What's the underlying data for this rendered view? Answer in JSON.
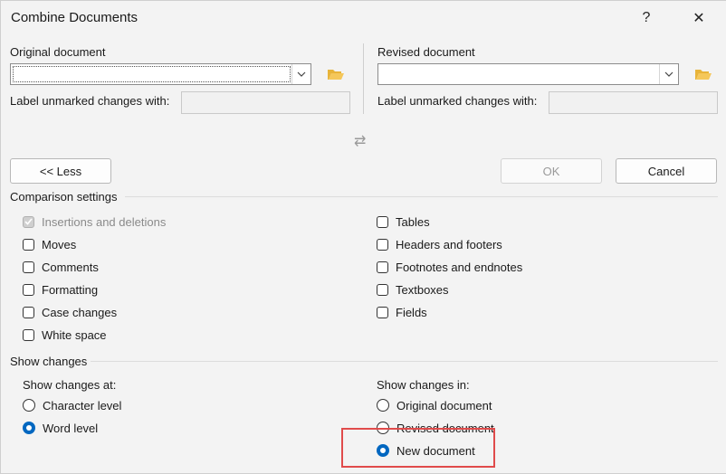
{
  "window": {
    "title": "Combine Documents",
    "help": "?",
    "close": "✕"
  },
  "original": {
    "heading": "Original document",
    "label_unmarked": "Label unmarked changes with:",
    "value": "",
    "label_value": ""
  },
  "revised": {
    "heading": "Revised document",
    "label_unmarked": "Label unmarked changes with:",
    "value": "",
    "label_value": ""
  },
  "swap_glyph": "⇄",
  "buttons": {
    "less": "<< Less",
    "ok": "OK",
    "cancel": "Cancel"
  },
  "comparison": {
    "heading": "Comparison settings",
    "left": [
      {
        "label": "Insertions and deletions",
        "checked": true,
        "disabled": true
      },
      {
        "label": "Moves",
        "checked": false
      },
      {
        "label": "Comments",
        "checked": false
      },
      {
        "label": "Formatting",
        "checked": false
      },
      {
        "label": "Case changes",
        "checked": false
      },
      {
        "label": "White space",
        "checked": false
      }
    ],
    "right": [
      {
        "label": "Tables",
        "checked": false
      },
      {
        "label": "Headers and footers",
        "checked": false
      },
      {
        "label": "Footnotes and endnotes",
        "checked": false
      },
      {
        "label": "Textboxes",
        "checked": false
      },
      {
        "label": "Fields",
        "checked": false
      }
    ]
  },
  "show": {
    "heading": "Show changes",
    "at_heading": "Show changes at:",
    "at_options": [
      {
        "label": "Character level",
        "selected": false
      },
      {
        "label": "Word level",
        "selected": true
      }
    ],
    "in_heading": "Show changes in:",
    "in_options": [
      {
        "label": "Original document",
        "selected": false
      },
      {
        "label": "Revised document",
        "selected": false
      },
      {
        "label": "New document",
        "selected": true
      }
    ]
  },
  "colors": {
    "accent": "#0067c0",
    "highlight": "#e04b4b"
  }
}
